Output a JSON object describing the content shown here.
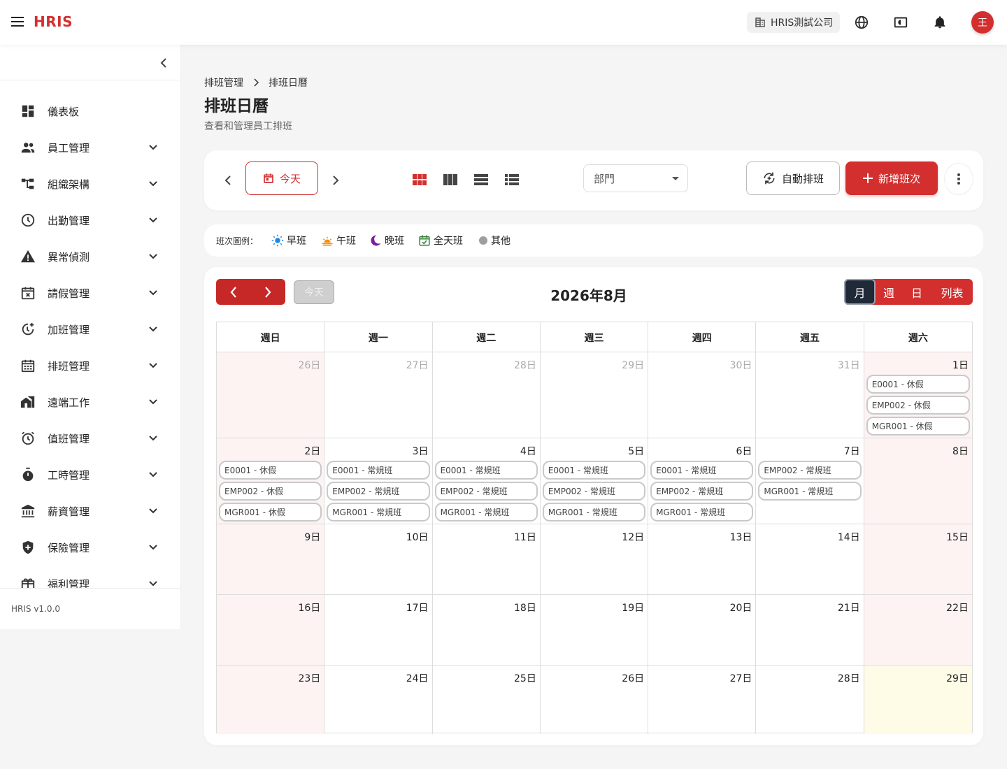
{
  "app": {
    "logo": "HRIS",
    "company": "HRIS測試公司",
    "avatar": "王",
    "version": "HRIS v1.0.0"
  },
  "sidebar": {
    "items": [
      {
        "label": "儀表板",
        "icon": "dashboard-icon",
        "expandable": false
      },
      {
        "label": "員工管理",
        "icon": "people-icon",
        "expandable": true
      },
      {
        "label": "組織架構",
        "icon": "org-chart-icon",
        "expandable": true
      },
      {
        "label": "出勤管理",
        "icon": "clock-icon",
        "expandable": true
      },
      {
        "label": "異常偵測",
        "icon": "warning-icon",
        "expandable": true
      },
      {
        "label": "請假管理",
        "icon": "calendar-x-icon",
        "expandable": true
      },
      {
        "label": "加班管理",
        "icon": "clock-plus-icon",
        "expandable": true
      },
      {
        "label": "排班管理",
        "icon": "calendar-grid-icon",
        "expandable": true
      },
      {
        "label": "遠端工作",
        "icon": "home-work-icon",
        "expandable": true
      },
      {
        "label": "值班管理",
        "icon": "alarm-icon",
        "expandable": true
      },
      {
        "label": "工時管理",
        "icon": "timer-icon",
        "expandable": true
      },
      {
        "label": "薪資管理",
        "icon": "bank-icon",
        "expandable": true
      },
      {
        "label": "保險管理",
        "icon": "shield-icon",
        "expandable": true
      },
      {
        "label": "福利管理",
        "icon": "gift-icon",
        "expandable": true
      }
    ]
  },
  "breadcrumb": {
    "parent": "排班管理",
    "current": "排班日曆"
  },
  "page": {
    "title": "排班日曆",
    "subtitle": "查看和管理員工排班"
  },
  "toolbar": {
    "today": "今天",
    "department_placeholder": "部門",
    "auto_schedule": "自動排班",
    "add_shift": "新增班次"
  },
  "legend": {
    "title": "班次圖例：",
    "items": [
      {
        "label": "早班",
        "icon": "sun-icon",
        "color": "#1e88e5"
      },
      {
        "label": "午班",
        "icon": "sunset-icon",
        "color": "#fb8c00"
      },
      {
        "label": "晚班",
        "icon": "moon-icon",
        "color": "#7b1fa2"
      },
      {
        "label": "全天班",
        "icon": "calendar-check-icon",
        "color": "#2e7d32"
      },
      {
        "label": "其他",
        "icon": "dot-icon",
        "color": "#9e9e9e"
      }
    ]
  },
  "calendar": {
    "title": "2026年8月",
    "today_label": "今天",
    "views": [
      "月",
      "週",
      "日",
      "列表"
    ],
    "active_view": "月",
    "weekdays": [
      "週日",
      "週一",
      "週二",
      "週三",
      "週四",
      "週五",
      "週六"
    ],
    "weeks": [
      [
        {
          "label": "26日",
          "other": true,
          "events": []
        },
        {
          "label": "27日",
          "other": true,
          "events": []
        },
        {
          "label": "28日",
          "other": true,
          "events": []
        },
        {
          "label": "29日",
          "other": true,
          "events": []
        },
        {
          "label": "30日",
          "other": true,
          "events": []
        },
        {
          "label": "31日",
          "other": true,
          "events": []
        },
        {
          "label": "1日",
          "events": [
            "E0001 - 休假",
            "EMP002 - 休假",
            "MGR001 - 休假"
          ]
        }
      ],
      [
        {
          "label": "2日",
          "events": [
            "E0001 - 休假",
            "EMP002 - 休假",
            "MGR001 - 休假"
          ]
        },
        {
          "label": "3日",
          "events": [
            "E0001 - 常規班",
            "EMP002 - 常規班",
            "MGR001 - 常規班"
          ]
        },
        {
          "label": "4日",
          "events": [
            "E0001 - 常規班",
            "EMP002 - 常規班",
            "MGR001 - 常規班"
          ]
        },
        {
          "label": "5日",
          "events": [
            "E0001 - 常規班",
            "EMP002 - 常規班",
            "MGR001 - 常規班"
          ]
        },
        {
          "label": "6日",
          "events": [
            "E0001 - 常規班",
            "EMP002 - 常規班",
            "MGR001 - 常規班"
          ]
        },
        {
          "label": "7日",
          "events": [
            "EMP002 - 常規班",
            "MGR001 - 常規班"
          ]
        },
        {
          "label": "8日",
          "events": []
        }
      ],
      [
        {
          "label": "9日",
          "events": []
        },
        {
          "label": "10日",
          "events": []
        },
        {
          "label": "11日",
          "events": []
        },
        {
          "label": "12日",
          "events": []
        },
        {
          "label": "13日",
          "events": []
        },
        {
          "label": "14日",
          "events": []
        },
        {
          "label": "15日",
          "events": []
        }
      ],
      [
        {
          "label": "16日",
          "events": []
        },
        {
          "label": "17日",
          "events": []
        },
        {
          "label": "18日",
          "events": []
        },
        {
          "label": "19日",
          "events": []
        },
        {
          "label": "20日",
          "events": []
        },
        {
          "label": "21日",
          "events": []
        },
        {
          "label": "22日",
          "events": []
        }
      ],
      [
        {
          "label": "23日",
          "events": []
        },
        {
          "label": "24日",
          "events": []
        },
        {
          "label": "25日",
          "events": []
        },
        {
          "label": "26日",
          "events": []
        },
        {
          "label": "27日",
          "events": []
        },
        {
          "label": "28日",
          "events": []
        },
        {
          "label": "29日",
          "today": true,
          "events": []
        }
      ]
    ]
  },
  "colors": {
    "primary": "#d32f2f",
    "primary_dark": "#c62828",
    "weekend_bg": "#fdf3f3",
    "today_bg": "#fefbe7"
  }
}
